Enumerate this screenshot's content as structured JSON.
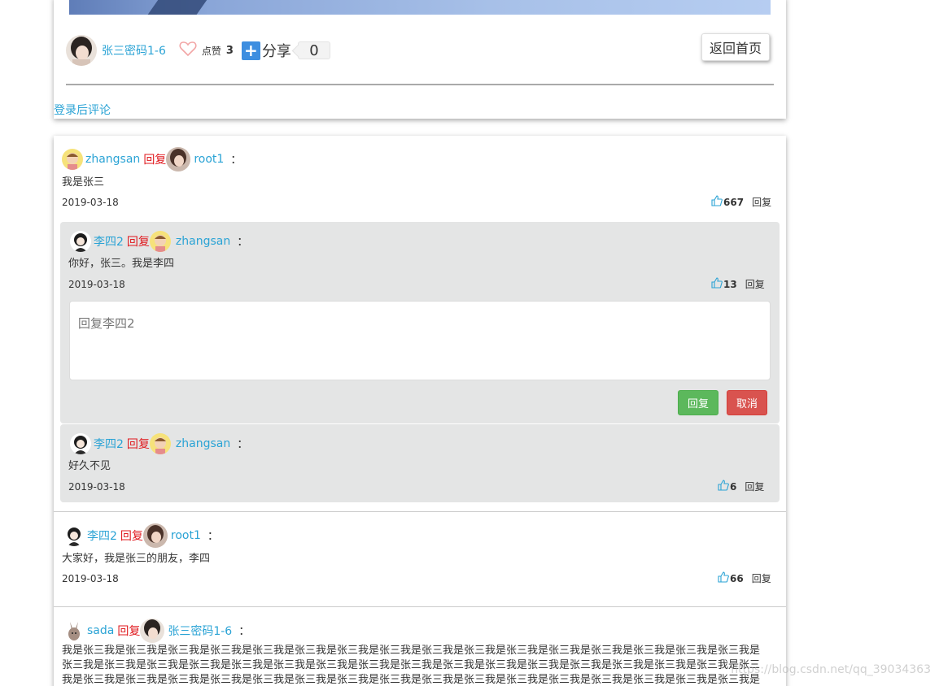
{
  "article": {
    "author_name": "张三密码1-6",
    "like_label": "点赞",
    "like_count": "3",
    "share_label": "分享",
    "share_count": "0",
    "back_home_label": "返回首页",
    "login_to_comment": "登录后评论"
  },
  "comments": [
    {
      "user": "zhangsan",
      "reply_word": "回复",
      "target": "root1",
      "colon": "：",
      "text": "我是张三",
      "date": "2019-03-18",
      "likes": "667",
      "reply_label": "回复"
    },
    {
      "user": "李四2",
      "reply_word": "回复",
      "target": "zhangsan",
      "colon": "：",
      "text": "你好，张三。我是李四",
      "date": "2019-03-18",
      "likes": "13",
      "reply_label": "回复",
      "reply_box": {
        "placeholder": "回复李四2",
        "submit_label": "回复",
        "cancel_label": "取消"
      }
    },
    {
      "user": "李四2",
      "reply_word": "回复",
      "target": "zhangsan",
      "colon": "：",
      "text": "好久不见",
      "date": "2019-03-18",
      "likes": "6",
      "reply_label": "回复"
    },
    {
      "user": "李四2",
      "reply_word": "回复",
      "target": "root1",
      "colon": "：",
      "text": "大家好，我是张三的朋友，李四",
      "date": "2019-03-18",
      "likes": "66",
      "reply_label": "回复"
    },
    {
      "user": "sada",
      "reply_word": "回复",
      "target": "张三密码1-6",
      "colon": "：",
      "text": "我是张三我是张三我是张三我是张三我是张三我是张三我是张三我是张三我是张三我是张三我是张三我是张三我是张三我是张三我是张三我是张三我是张三我是张三我是张三我是张三我是张三我是张三我是张三我是张三我是张三我是张三我是张三我是张三我是张三我是张三我是张三我是张三我是张三我是张三我是张三我是张三我是张三我是张三我是张三我是张三我是张三我是张三我是张三我是张三我是张三我是张三我是张三我是张三我是张三我是张三我是张三我是张三我是张三我是张三我是张三我是张三我是"
    }
  ],
  "watermark": "https://blog.csdn.net/qq_39034363",
  "colors": {
    "link": "#2aa3d5",
    "reply_word": "#e0191e",
    "sub_box_bg": "#e4e5e5",
    "btn_reply": "#5cb85c",
    "btn_cancel": "#d9534f"
  }
}
